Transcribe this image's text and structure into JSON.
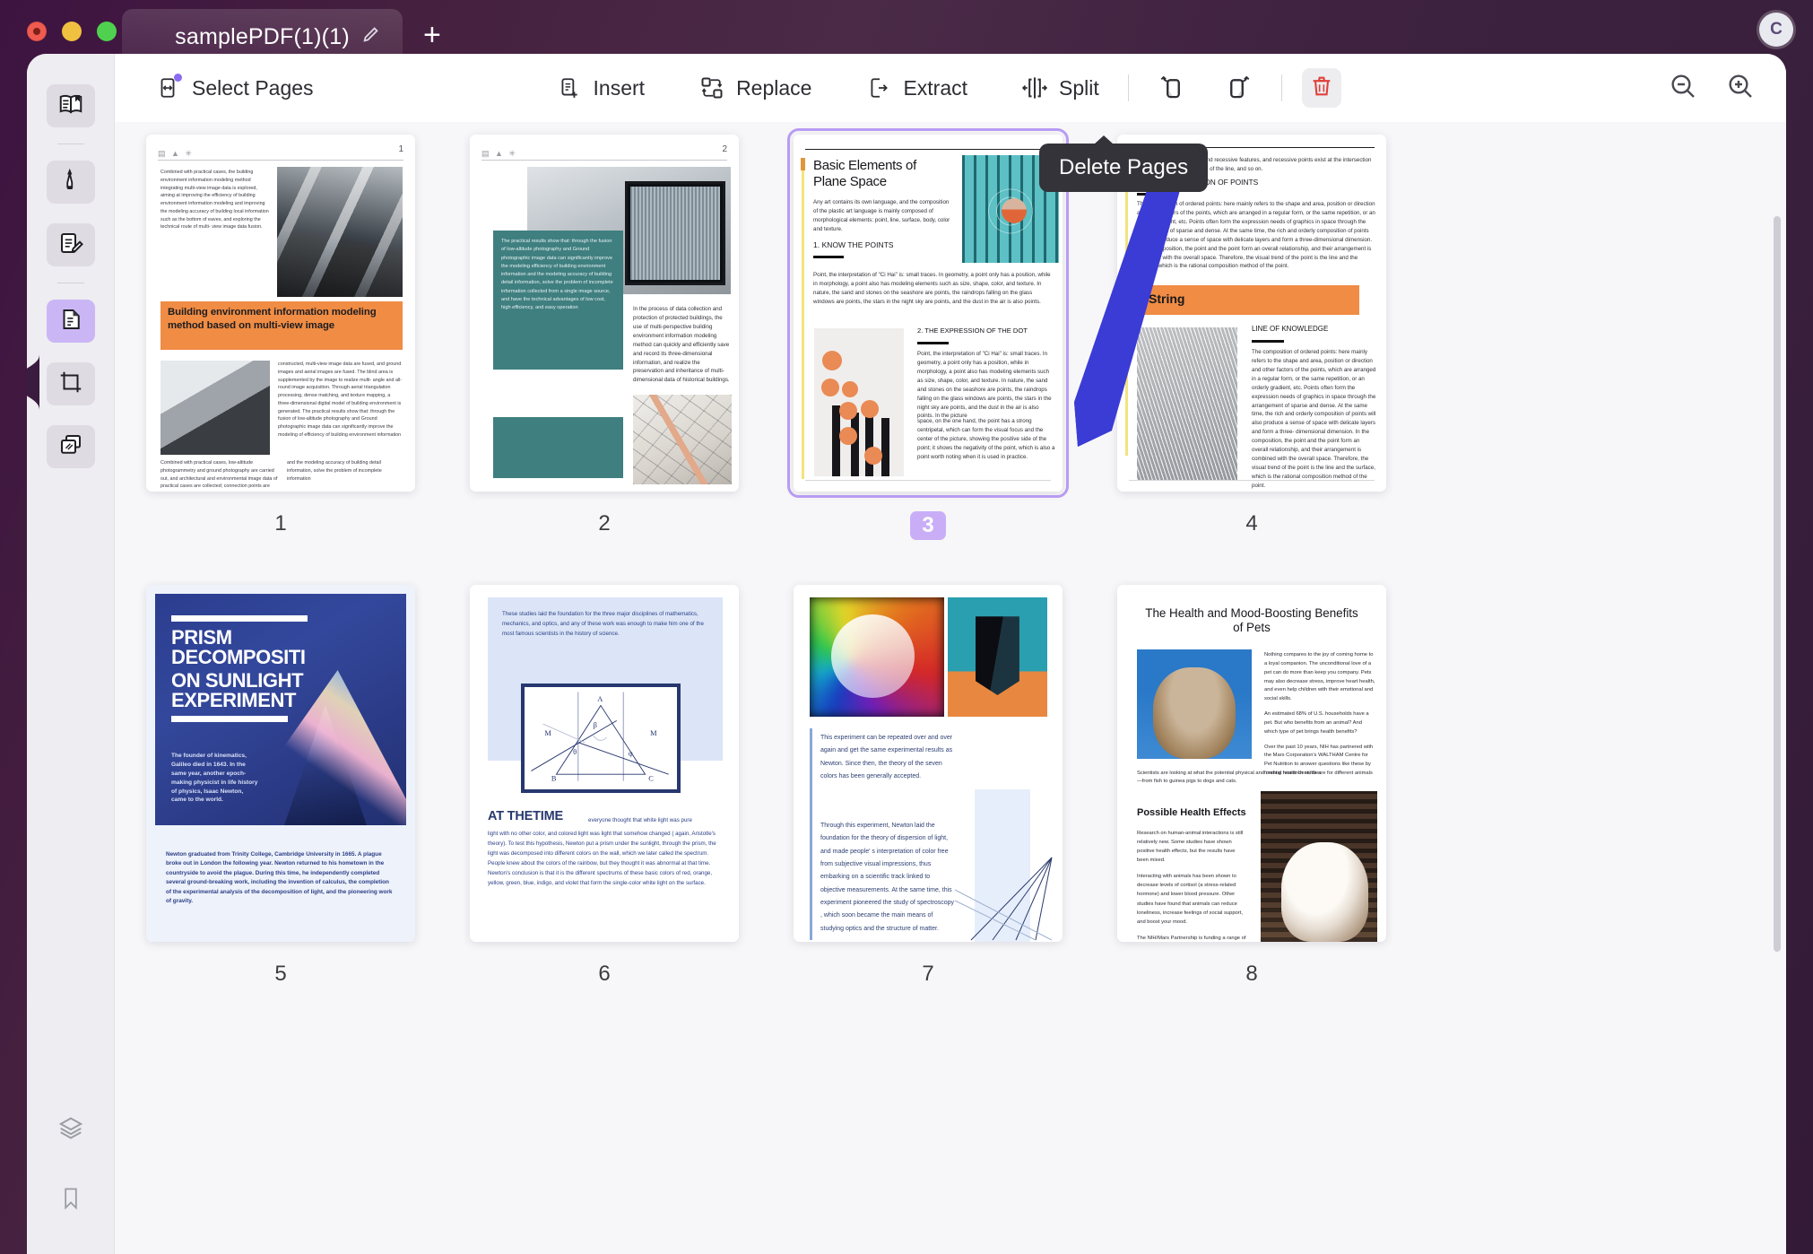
{
  "window": {
    "tab_title": "samplePDF(1)(1)",
    "new_tab_label": "+",
    "edit_icon": "pencil-icon",
    "avatar_initial": "C",
    "accent_purple": "#8a6cf0",
    "selection_purple": "#c9aef7",
    "delete_red": "#e0403a"
  },
  "toolbar": {
    "select_pages": "Select Pages",
    "insert": "Insert",
    "replace": "Replace",
    "extract": "Extract",
    "split": "Split",
    "rotate_left": "rotate-left-icon",
    "rotate_right": "rotate-right-icon",
    "delete": "delete-pages-icon",
    "zoom_out": "zoom-out-icon",
    "zoom_in": "zoom-in-icon",
    "tooltip": "Delete Pages"
  },
  "sidebar": {
    "items": [
      {
        "icon": "read-mode-icon",
        "state": "default"
      },
      {
        "icon": "highlighter-icon",
        "state": "default"
      },
      {
        "icon": "annotate-edit-icon",
        "state": "default"
      },
      {
        "icon": "organize-pages-icon",
        "state": "active"
      },
      {
        "icon": "crop-icon",
        "state": "default"
      },
      {
        "icon": "compress-copy-icon",
        "state": "default"
      }
    ],
    "bottom_items": [
      {
        "icon": "layers-icon",
        "state": "default"
      },
      {
        "icon": "bookmark-icon",
        "state": "default"
      }
    ]
  },
  "pages": [
    {
      "number": "1",
      "selected": false,
      "kind": "p1"
    },
    {
      "number": "2",
      "selected": false,
      "kind": "p2"
    },
    {
      "number": "3",
      "selected": true,
      "kind": "p3"
    },
    {
      "number": "4",
      "selected": false,
      "kind": "p4"
    },
    {
      "number": "5",
      "selected": false,
      "kind": "p5"
    },
    {
      "number": "6",
      "selected": false,
      "kind": "p6"
    },
    {
      "number": "7",
      "selected": false,
      "kind": "p7"
    },
    {
      "number": "8",
      "selected": false,
      "kind": "p8"
    }
  ],
  "page1": {
    "header_glyphs": "▤ ▲ ✳",
    "page_num": "1",
    "col1": "Combined with practical cases, the building environment information modeling method integrating multi-view image data is explored, aiming at improving the efficiency of building environment information modeling and improving the modeling accuracy of building local information such as the bottom of eaves, and exploring the technical route of multi- view image data fusion.",
    "banner": "Building environment information modeling method based on multi-view image",
    "col2": "constructed, multi-view image data are fused, and ground images and aerial images are fused. The blind area is supplemented by the image to realize multi- angle and all-round image acquisition. Through aerial triangulation processing, dense matching, and texture mapping, a three-dimensional digital model of building environment is generated. The practical results show that: through the fusion of low-altitude photography and Ground photographic image data can significantly improve the modeling of efficiency of building environment information",
    "col3": "Combined with practical cases, low-altitude photogrammetry and ground photography are carried out, and architectural and environmental image data of practical cases are collected; connection points are constructed, multi-view image data are",
    "col4": "and the modeling accuracy of building detail information, solve the problem of incomplete information"
  },
  "page2": {
    "header_glyphs": "▤ ▲ ✳",
    "page_num": "2",
    "teal_text": "The practical results show that: through the fusion of low-altitude photography and Ground photographic image data can significantly improve the modeling efficiency of building environment information and the modeling accuracy of building detail information, solve the problem of incomplete information collected from a single image source, and have the technical advantages of low cost, high efficiency, and easy operation",
    "right_text": "In the process of data collection and protection of protected buildings, the use of multi-perspective building environment information modeling method can quickly and efficiently save and record its three-dimensional information, and realize the preservation and inheritance of multi-dimensional data of historical buildings."
  },
  "page3": {
    "title": "Basic Elements of Plane Space",
    "intro": "Any art contains its own language, and the composition of the plastic art language is mainly composed of morphological elements: point, line, surface, body, color and texture.",
    "h1": "1. KNOW THE POINTS",
    "body1": "Point, the interpretation of \"Ci Hai\" is: small traces. In geometry, a point only has a position, while in morphology, a point also has modeling elements such as size, shape, color, and texture. In nature, the sand and stones on the seashore are points, the raindrops falling on the glass windows are points, the stars in the night sky are points, and the dust in the air is also points.",
    "h2": "2. THE  EXPRESSION     OF  THE DOT",
    "body2": "Point, the interpretation of \"Ci Hai\" is: small traces. In geometry, a point only has a position, while in morphology, a point also has modeling elements such as size, shape, color, and texture. In nature, the sand and stones on the seashore are points, the raindrops falling on the glass windows are points, the stars in the night sky are points, and the dust in the air is also points. In the picture",
    "body3": "space, on the one hand, the point has a strong centripetal, which can form the visual focus and the center of the picture, showing the positive side of the point; it shows the negativity of the point, which is also a point worth noting when it is used in practice."
  },
  "page4": {
    "intro": "Points also have dominant and recessive features, and recessive points exist at the intersection of two lines, at the top or end of the line, and so on.",
    "h1": "3. THE COMPOSITION OF POINTS",
    "body1": "The composition of ordered points: here mainly refers to the shape and area, position or direction and other factors of the points, which are arranged in a regular form, or the same repetition, or an orderly gradient, etc. Points often form the expression needs of graphics in space through the arrangement of sparse and dense. At the same time, the rich and orderly composition of points will also produce a sense of space with delicate layers and form a three-dimensional dimension. In the composition, the point and the point form an overall relationship, and their arrangement is combined with the overall space. Therefore, the visual trend of the point is the line and the surface, which is the rational composition method of the point.",
    "banner": "String",
    "h2": "LINE OF KNOWLEDGE",
    "body2": "The composition of ordered points: here mainly refers to the shape and area, position or direction and other factors of the points, which are arranged in a regular form, or the same repetition, or an orderly gradient, etc. Points often form the expression needs of graphics in space through the arrangement of sparse and dense. At the same time, the rich and orderly composition of points will also produce a sense of space with delicate layers and form a three- dimensional dimension. In the composition, the point and the point form an overall relationship, and their arrangement is combined with the overall space. Therefore, the visual trend of the point is the line and the surface, which is the rational composition method of the point."
  },
  "page5": {
    "title_line1": "PRISM DECOMPOSITI",
    "title_line2": "ON SUNLIGHT EXPERIMENT",
    "hero_text": "The founder of kinematics, Galileo died in 1643. In the same year, another epoch-making physicist in life history of physics, Isaac Newton, came to the world.",
    "body": "Newton graduated from Trinity College, Cambridge University in 1665. A plague broke out in London the following year. Newton returned to his hometown in the countryside to avoid the plague. During this time, he independently completed several ground-breaking work, including the invention of calculus, the completion of the experimental analysis of the decomposition of light, and the pioneering work of gravity."
  },
  "page6": {
    "box_text": "These studies laid the foundation for the three major disciplines of mathematics, mechanics, and optics, and any of these work was enough to make him one of the most famous scientists in the history of science.",
    "figure_labels": [
      "A",
      "B",
      "C",
      "M",
      "M",
      "β",
      "θ",
      "φ"
    ],
    "heading": "AT THETIME",
    "cont": "everyone thought that white light was pure",
    "body": "light with no other color, and colored light was light that somehow changed ( again, Aristotle's theory). To test this hypothesis, Newton put a prism under the sunlight, through the prism, the light was decomposed into different colors on the wall, which we later called the spectrum. People knew about the colors of the rainbow, but they thought it was abnormal at that time.\nNewton's conclusion is that it is the different spectrums of these basic colors of red, orange, yellow, green, blue, indigo, and violet that form the single-color white light on the surface."
  },
  "page7": {
    "para1": "This experiment can be repeated over and over again and get the same experimental results as Newton. Since then, the theory of the seven colors has been generally accepted.",
    "para2": "Through this experiment, Newton laid the foundation for the theory of dispersion of light, and made people' s interpretation of color free from subjective visual impressions, thus embarking on a scientific track linked to objective measurements. At the same time, this experiment pioneered the study of spectroscopy , which soon became the main means of studying optics and the structure of matter."
  },
  "page8": {
    "title": "The Health and Mood-Boosting Benefits of Pets",
    "para1": "Nothing compares to the joy of coming home to a loyal companion. The unconditional love of a pet can do more than keep you company. Pets may also decrease stress, improve heart health, and even help children with their emotional and social skills.",
    "para2": "An estimated 68% of U.S. households have a pet. But who benefits from an animal? And which type of pet brings health benefits?",
    "para3": "Over the past 10 years, NIH has partnered with the Mars Corporation's WALTHAM Centre for Pet Nutrition to answer questions like these by funding research studies.",
    "wide": "Scientists are looking at what the potential physical and mental health benefits are for different animals—from fish to guinea pigs to dogs and cats.",
    "h2": "Possible Health Effects",
    "para4": "Research on human-animal interactions is still relatively new. Some studies have shown positive health effects, but the results have been mixed.",
    "para5": "Interacting with animals has been shown to decrease levels of cortisol (a stress-related hormone) and lower blood pressure. Other studies have found that animals can reduce loneliness, increase feelings of social support, and boost your mood.",
    "para6": "The NIH/Mars Partnership is funding a range of studies focused on the relationships we have with animals. For example, researchers are looking into how animals might influence child development. They're studying animal interactions with kids who have autism, attention deficit hyperactivity disorder (ADHD), and other conditions."
  }
}
